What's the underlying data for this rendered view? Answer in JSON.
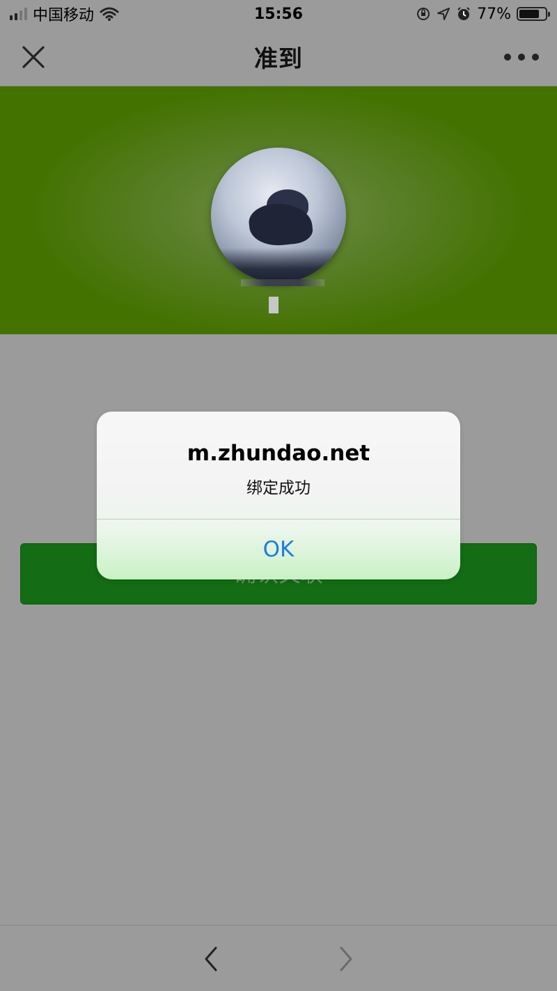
{
  "status_bar": {
    "carrier": "中国移动",
    "time": "15:56",
    "battery_percent": "77%",
    "battery_level": 0.77,
    "icons": [
      "signal-icon",
      "wifi-icon",
      "orientation-lock-icon",
      "location-icon",
      "alarm-icon",
      "battery-icon"
    ]
  },
  "nav": {
    "title": "准到",
    "close_icon": "close-icon",
    "more_icon": "more-dots-icon"
  },
  "confirm_button": {
    "label": "确认关联"
  },
  "alert": {
    "title": "m.zhundao.net",
    "message": "绑定成功",
    "ok_label": "OK"
  },
  "toolbar": {
    "back_icon": "chevron-left-icon",
    "forward_icon": "chevron-right-icon"
  },
  "colors": {
    "banner_green": "#437200",
    "button_green": "#146c14",
    "alert_link_blue": "#1d7ce2",
    "overlay_gray": "#9b9b9b"
  }
}
